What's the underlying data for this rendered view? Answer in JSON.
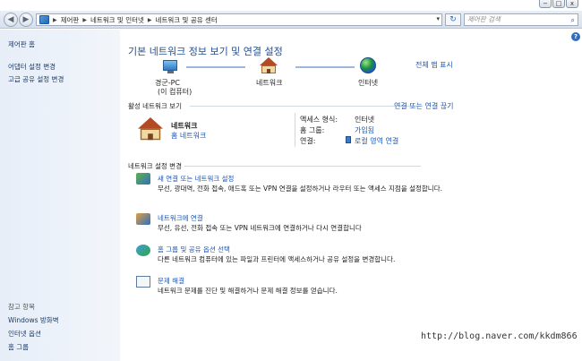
{
  "window": {
    "minimize": "−",
    "maximize": "□",
    "close": "x"
  },
  "address_bar": {
    "back": "◀",
    "forward": "▶",
    "crumbs": [
      "제어판",
      "네트워크 및 인터넷",
      "네트워크 및 공유 센터"
    ],
    "separator": "▶",
    "dropdown": "▾",
    "refresh": "↻",
    "search_placeholder": "제어판 검색",
    "search_icon": "⌕"
  },
  "sidebar": {
    "home": "제어판 홈",
    "links": [
      "어댑터 설정 변경",
      "고급 공유 설정 변경"
    ],
    "see_also_title": "참고 항목",
    "see_also": [
      "Windows 방화벽",
      "인터넷 옵션",
      "홈 그룹"
    ]
  },
  "main": {
    "help": "?",
    "title": "기본 네트워크 정보 보기 및 연결 설정",
    "full_map": "전체 맵 표시",
    "map": {
      "pc_name": "경군-PC",
      "pc_sub": "(이 컴퓨터)",
      "network": "네트워크",
      "internet": "인터넷"
    },
    "active_section": "활성 네트워크 보기",
    "connect_disconnect": "연결 또는 연결 끊기",
    "network": {
      "name": "네트워크",
      "type": "홈 네트워크",
      "access_label": "액세스 형식:",
      "access_value": "인터넷",
      "homegroup_label": "홈 그룹:",
      "homegroup_value": "가입됨",
      "connections_label": "연결:",
      "connections_value": "로컬 영역 연결"
    },
    "change_section": "네트워크 설정 변경",
    "tasks": [
      {
        "title": "새 연결 또는 네트워크 설정",
        "desc": "무선, 광대역, 전화 접속, 애드혹 또는 VPN 연결을 설정하거나 라우터 또는 액세스 지점을 설정합니다."
      },
      {
        "title": "네트워크에 연결",
        "desc": "무선, 유선, 전화 접속 또는 VPN 네트워크에 연결하거나 다시 연결합니다"
      },
      {
        "title": "홈 그룹 및 공유 옵션 선택",
        "desc": "다른 네트워크 컴퓨터에 있는 파일과 프린터에 액세스하거나 공유 설정을 변경합니다."
      },
      {
        "title": "문제 해결",
        "desc": "네트워크 문제를 진단 및 해결하거나 문제 해결 정보를 얻습니다."
      }
    ]
  },
  "watermark": "http://blog.naver.com/kkdm866",
  "colors": {
    "link": "#1c57b5",
    "title": "#1f4f97",
    "sidebar_bg": "#e7eef8"
  }
}
